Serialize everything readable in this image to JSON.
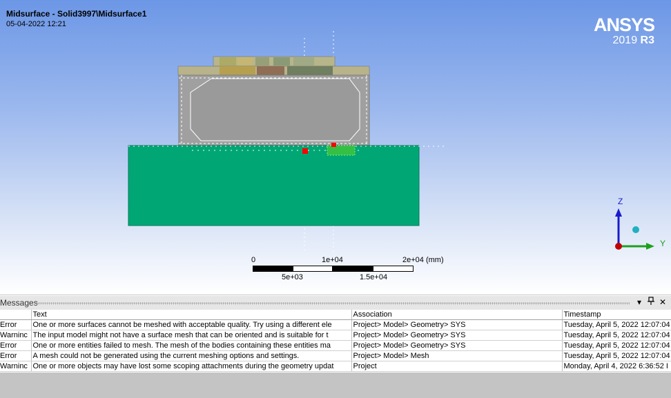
{
  "viewport": {
    "title": "Midsurface - Solid3997\\Midsurface1",
    "date": "05-04-2022 12:21",
    "logo_brand": "ANSYS",
    "logo_year": "2019",
    "logo_release": "R3",
    "colors": {
      "slab": "#00a774",
      "body": "#9f9f9f",
      "marker": "#ff0000"
    }
  },
  "scale": {
    "top_labels": [
      "0",
      "1e+04",
      "2e+04 (mm)"
    ],
    "bottom_labels": [
      "5e+03",
      "1.5e+04"
    ]
  },
  "triad": {
    "z": "Z",
    "y": "Y"
  },
  "messages": {
    "title": "Messages",
    "buttons": {
      "menu": "▾",
      "pin": "📌",
      "close": "✕"
    },
    "columns": [
      "",
      "Text",
      "Association",
      "Timestamp"
    ],
    "rows": [
      {
        "type": "Error",
        "text": "One or more surfaces cannot be meshed with acceptable quality. Try using a different ele",
        "assoc": "Project> Model> Geometry> SYS",
        "time": "Tuesday, April 5, 2022 12:07:04"
      },
      {
        "type": "Warninc",
        "text": "The input model might not have a surface mesh that can be oriented and is suitable for t",
        "assoc": "Project> Model> Geometry> SYS",
        "time": "Tuesday, April 5, 2022 12:07:04"
      },
      {
        "type": "Error",
        "text": "One or more entities failed to mesh. The mesh of the bodies containing these entities ma",
        "assoc": "Project> Model> Geometry> SYS",
        "time": "Tuesday, April 5, 2022 12:07:04"
      },
      {
        "type": "Error",
        "text": "A mesh could not be generated using the current meshing options and settings.",
        "assoc": "Project> Model> Mesh",
        "time": "Tuesday, April 5, 2022 12:07:04"
      },
      {
        "type": "Warninc",
        "text": "One or more objects may have lost some scoping attachments during the geometry updat",
        "assoc": "Project",
        "time": "Monday, April 4, 2022 6:36:52 I"
      }
    ]
  }
}
